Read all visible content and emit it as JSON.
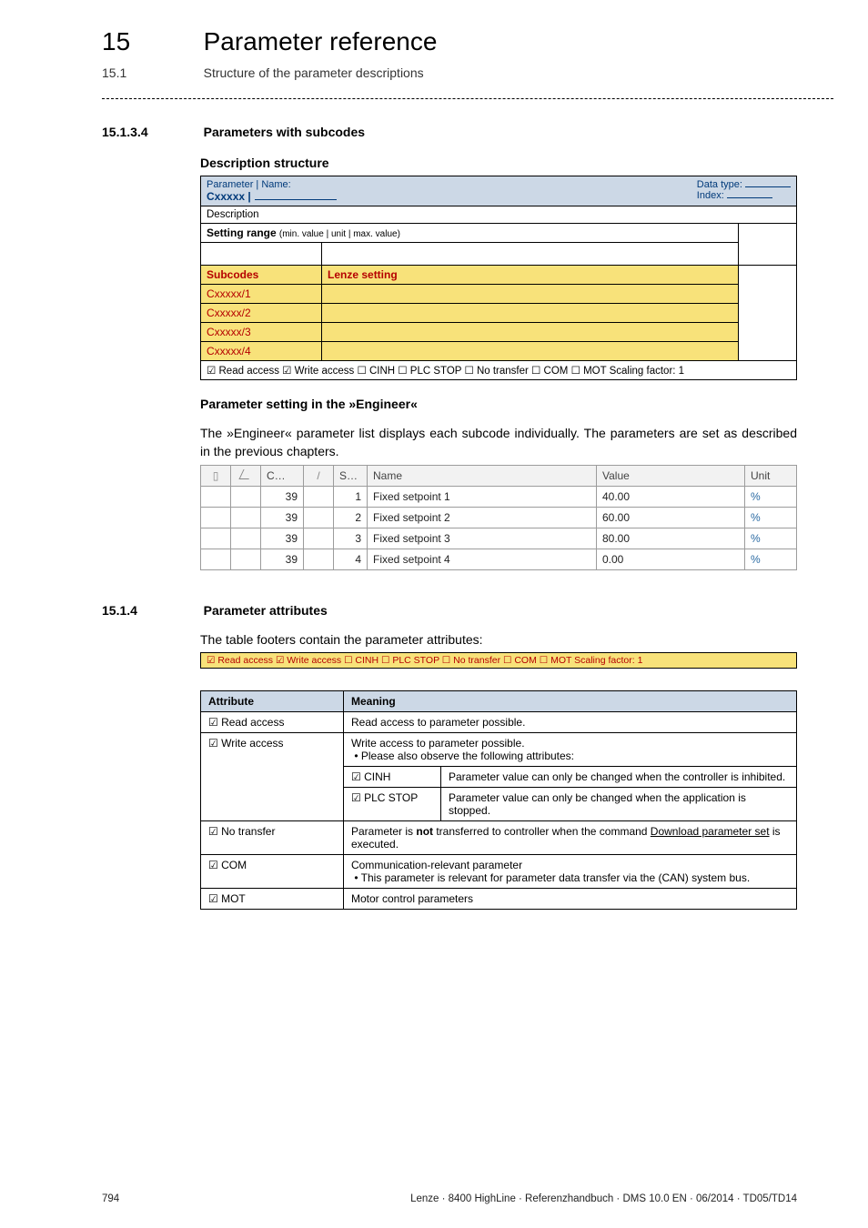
{
  "chapter": {
    "num": "15",
    "title": "Parameter reference"
  },
  "section": {
    "num": "15.1",
    "title": "Structure of the parameter descriptions"
  },
  "h3a": {
    "num": "15.1.3.4",
    "title": "Parameters with subcodes"
  },
  "h4a": "Description structure",
  "desc": {
    "pname": "Parameter | Name:",
    "cxx": "Cxxxxx |",
    "dtype": "Data type:",
    "idx": "Index:",
    "row_desc": "Description",
    "setting_label": "Setting range",
    "setting_small": "(min. value | unit | max. value)",
    "subcodes": "Subcodes",
    "lenze": "Lenze setting",
    "sc1": "Cxxxxx/1",
    "sc2": "Cxxxxx/2",
    "sc3": "Cxxxxx/3",
    "sc4": "Cxxxxx/4",
    "foot": "☑ Read access   ☑ Write access   ☐ CINH   ☐ PLC STOP   ☐ No transfer   ☐ COM   ☐ MOT     Scaling factor: 1"
  },
  "h4b": "Parameter setting in the »Engineer«",
  "eng_para": "The »Engineer« parameter list displays each subcode individually. The parameters are set as described in the previous chapters.",
  "eng_head": {
    "c": "C…",
    "s": "S…",
    "name": "Name",
    "value": "Value",
    "unit": "Unit"
  },
  "eng_rows": [
    {
      "c": "39",
      "s": "1",
      "name": "Fixed setpoint 1",
      "value": "40.00",
      "unit": "%"
    },
    {
      "c": "39",
      "s": "2",
      "name": "Fixed setpoint 2",
      "value": "60.00",
      "unit": "%"
    },
    {
      "c": "39",
      "s": "3",
      "name": "Fixed setpoint 3",
      "value": "80.00",
      "unit": "%"
    },
    {
      "c": "39",
      "s": "4",
      "name": "Fixed setpoint 4",
      "value": "0.00",
      "unit": "%"
    }
  ],
  "h3b": {
    "num": "15.1.4",
    "title": "Parameter attributes"
  },
  "attr_para": "The table footers contain the parameter attributes:",
  "footbar": "☑ Read access   ☑ Write access   ☐ CINH   ☐ PLC STOP   ☐ No transfer   ☐ COM   ☐ MOT     Scaling factor: 1",
  "mean": {
    "hdr_attr": "Attribute",
    "hdr_mean": "Meaning",
    "r1a": "☑ Read access",
    "r1b": "Read access to parameter possible.",
    "r2a": "☑ Write access",
    "r2b_line1": "Write access to parameter possible.",
    "r2b_line2": "• Please also observe the following attributes:",
    "r3a": "☑ CINH",
    "r3b": "Parameter value can only be changed when the controller is inhibited.",
    "r4a": "☑ PLC STOP",
    "r4b": "Parameter value can only be changed when the application is stopped.",
    "r5a": "☑ No transfer",
    "r5b_pre": "Parameter is ",
    "r5b_bold": "not",
    "r5b_mid": " transferred to controller when the command ",
    "r5b_link": "Download parameter set",
    "r5b_post": " is executed.",
    "r6a": "☑ COM",
    "r6b_line1": "Communication-relevant parameter",
    "r6b_line2": "• This parameter is relevant for parameter data transfer via the (CAN) system bus.",
    "r7a": "☑ MOT",
    "r7b": "Motor control parameters"
  },
  "page_num": "794",
  "footer_right": "Lenze · 8400 HighLine · Referenzhandbuch · DMS 10.0 EN · 06/2014 · TD05/TD14",
  "chart_data": {
    "type": "table",
    "title": "Engineer parameter list – fixed setpoints (C39)",
    "columns": [
      "C…",
      "S…",
      "Name",
      "Value",
      "Unit"
    ],
    "rows": [
      [
        "39",
        "1",
        "Fixed setpoint 1",
        40.0,
        "%"
      ],
      [
        "39",
        "2",
        "Fixed setpoint 2",
        60.0,
        "%"
      ],
      [
        "39",
        "3",
        "Fixed setpoint 3",
        80.0,
        "%"
      ],
      [
        "39",
        "4",
        "Fixed setpoint 4",
        0.0,
        "%"
      ]
    ]
  }
}
